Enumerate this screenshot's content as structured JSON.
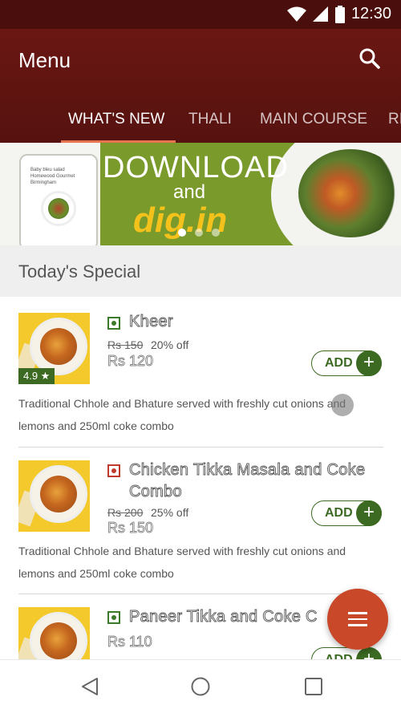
{
  "status_bar": {
    "time": "12:30",
    "icons": [
      "wifi-icon",
      "signal-icon",
      "battery-icon"
    ]
  },
  "app_bar": {
    "title": "Menu",
    "search_icon": "search-icon"
  },
  "tabs": [
    {
      "label": "WHAT'S NEW",
      "active": true
    },
    {
      "label": "THALI",
      "active": false
    },
    {
      "label": "MAIN COURSE",
      "active": false
    },
    {
      "label": "RI",
      "active": false
    }
  ],
  "banner": {
    "line1": "DOWNLOAD",
    "line2": "and",
    "line3": "dig.in",
    "phone_text": "Baby bleu salad Homewood Gourmet Birmingham",
    "slides": 3,
    "active_slide": 1
  },
  "section": {
    "title": "Today's Special"
  },
  "items": [
    {
      "name": "Kheer",
      "type": "veg",
      "rating": "4.9 ★",
      "old_price": "Rs 150",
      "discount": "20% off",
      "price": "Rs 120",
      "add_label": "ADD",
      "description": "Traditional Chhole and Bhature served with freshly cut onions and lemons and 250ml coke combo"
    },
    {
      "name": "Chicken Tikka Masala and Coke Combo",
      "type": "non-veg",
      "old_price": "Rs 200",
      "discount": "25% off",
      "price": "Rs 150",
      "add_label": "ADD",
      "description": "Traditional Chhole and Bhature served with freshly cut onions and lemons and 250ml coke combo"
    },
    {
      "name": "Paneer Tikka and Coke C",
      "type": "veg",
      "price": "Rs 110",
      "add_label": "ADD"
    }
  ],
  "fab": {
    "icon": "menu-icon"
  },
  "nav_bar": {
    "icons": [
      "back-icon",
      "home-icon",
      "recents-icon"
    ]
  },
  "colors": {
    "primary": "#5e1410",
    "accent": "#c9482a",
    "veg": "#3c7a2a",
    "nonveg": "#c0392b",
    "tab_indicator": "#e8734f"
  }
}
